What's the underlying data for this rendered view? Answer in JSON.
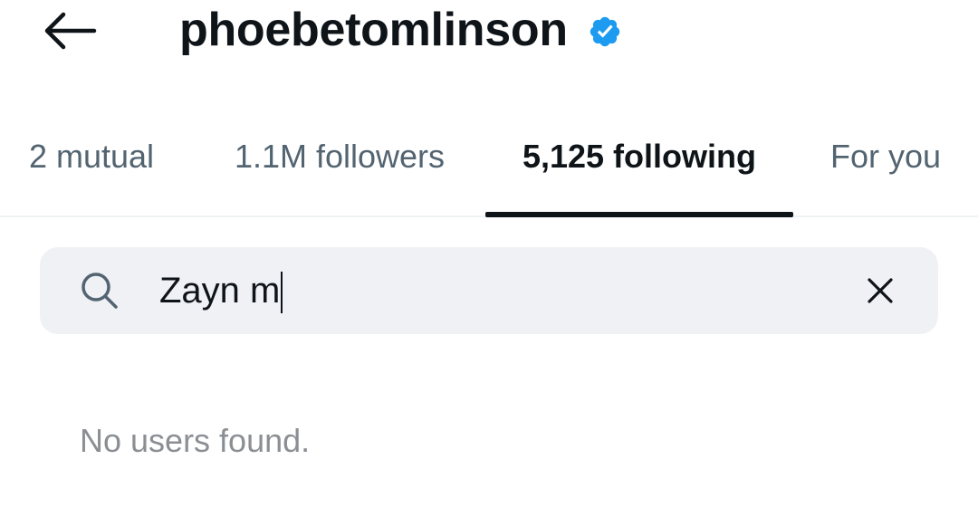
{
  "header": {
    "username": "phoebetomlinson",
    "verified": true,
    "verified_color": "#1d9bf0",
    "back_icon": "arrow-left-icon"
  },
  "tabs": [
    {
      "label": "2 mutual",
      "active": false
    },
    {
      "label": "1.1M followers",
      "active": false
    },
    {
      "label": "5,125 following",
      "active": true
    },
    {
      "label": "For you",
      "active": false
    }
  ],
  "search": {
    "value": "Zayn m",
    "icon": "search-icon",
    "clear_icon": "close-icon"
  },
  "results": {
    "empty_message": "No users found."
  }
}
